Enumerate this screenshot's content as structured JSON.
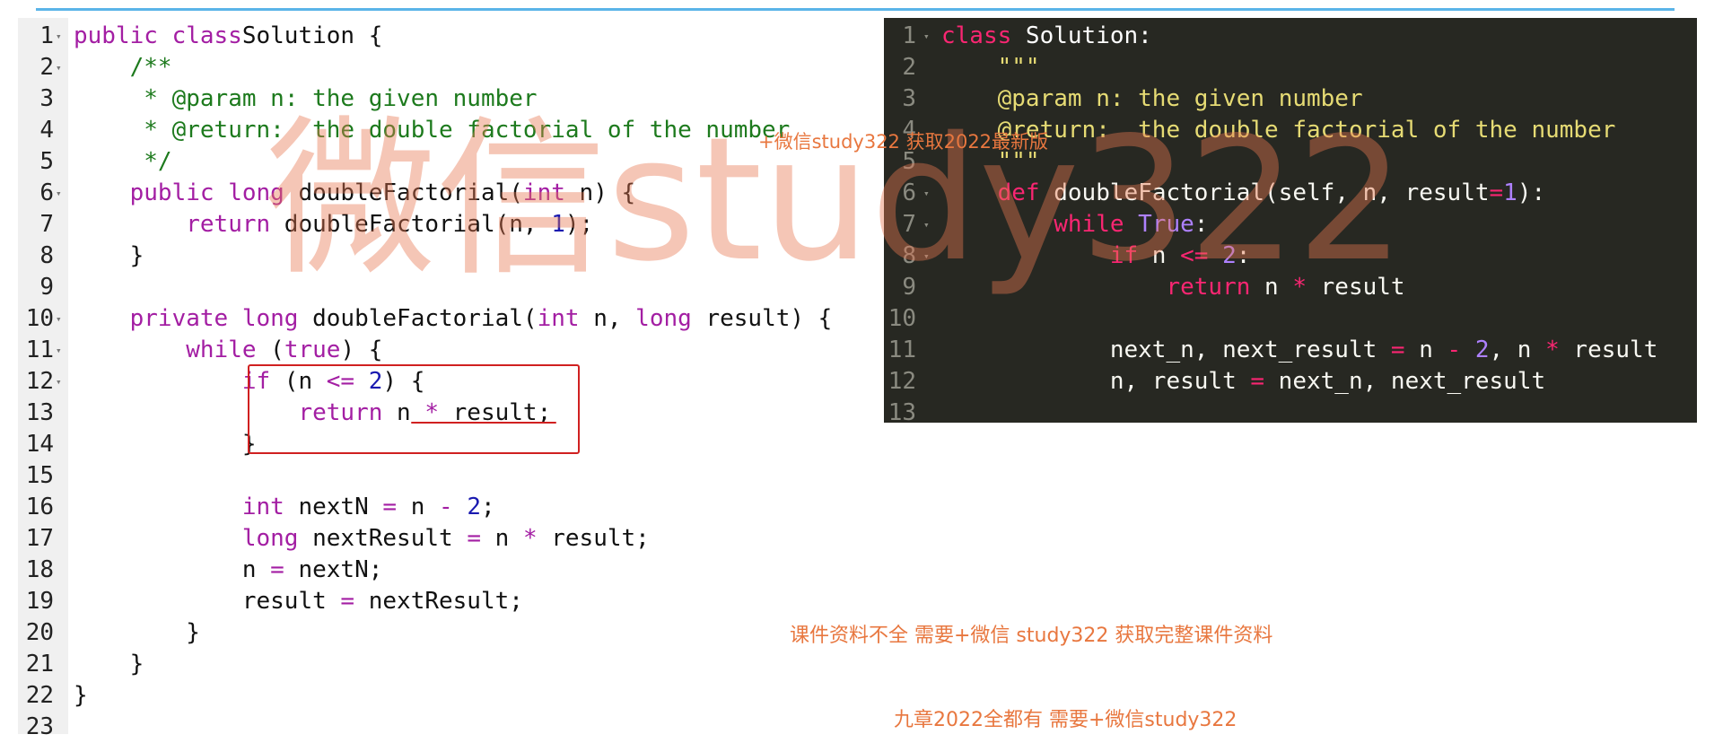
{
  "java_editor": {
    "lines": [
      {
        "n": "1",
        "fold": true,
        "t": [
          [
            "kw",
            "public class"
          ],
          [
            "",
            "Solution {"
          ]
        ]
      },
      {
        "n": "2",
        "fold": true,
        "t": [
          [
            "",
            "    "
          ],
          [
            "cm",
            "/**"
          ]
        ]
      },
      {
        "n": "3",
        "fold": false,
        "t": [
          [
            "",
            "     "
          ],
          [
            "cm",
            "* @param n: the given number"
          ]
        ]
      },
      {
        "n": "4",
        "fold": false,
        "t": [
          [
            "",
            "     "
          ],
          [
            "cm",
            "* @return:  the double factorial of the number"
          ]
        ]
      },
      {
        "n": "5",
        "fold": false,
        "t": [
          [
            "",
            "     "
          ],
          [
            "cm",
            "*/"
          ]
        ]
      },
      {
        "n": "6",
        "fold": true,
        "t": [
          [
            "",
            "    "
          ],
          [
            "kw",
            "public long"
          ],
          [
            "",
            " doubleFactorial("
          ],
          [
            "kw",
            "int"
          ],
          [
            "",
            " n) {"
          ]
        ]
      },
      {
        "n": "7",
        "fold": false,
        "t": [
          [
            "",
            "        "
          ],
          [
            "kw",
            "return"
          ],
          [
            "",
            " doubleFactorial(n, "
          ],
          [
            "nm",
            "1"
          ],
          [
            "",
            ");"
          ]
        ]
      },
      {
        "n": "8",
        "fold": false,
        "t": [
          [
            "",
            "    }"
          ]
        ]
      },
      {
        "n": "9",
        "fold": false,
        "t": []
      },
      {
        "n": "10",
        "fold": true,
        "t": [
          [
            "",
            "    "
          ],
          [
            "kw",
            "private long"
          ],
          [
            "",
            " doubleFactorial("
          ],
          [
            "kw",
            "int"
          ],
          [
            "",
            " n, "
          ],
          [
            "kw",
            "long"
          ],
          [
            "",
            " result) {"
          ]
        ]
      },
      {
        "n": "11",
        "fold": true,
        "t": [
          [
            "",
            "        "
          ],
          [
            "kw",
            "while"
          ],
          [
            "",
            " ("
          ],
          [
            "kw",
            "true"
          ],
          [
            "",
            ") {"
          ]
        ]
      },
      {
        "n": "12",
        "fold": true,
        "t": [
          [
            "",
            "            "
          ],
          [
            "kw",
            "if"
          ],
          [
            "",
            " (n "
          ],
          [
            "op",
            "<="
          ],
          [
            "",
            " "
          ],
          [
            "nm",
            "2"
          ],
          [
            "",
            ") {"
          ]
        ]
      },
      {
        "n": "13",
        "fold": false,
        "t": [
          [
            "",
            "                "
          ],
          [
            "kw",
            "return"
          ],
          [
            "",
            " n "
          ],
          [
            "op",
            "*"
          ],
          [
            "",
            " result;"
          ]
        ]
      },
      {
        "n": "14",
        "fold": false,
        "t": [
          [
            "",
            "            }"
          ]
        ]
      },
      {
        "n": "15",
        "fold": false,
        "t": []
      },
      {
        "n": "16",
        "fold": false,
        "t": [
          [
            "",
            "            "
          ],
          [
            "kw",
            "int"
          ],
          [
            "",
            " nextN "
          ],
          [
            "op",
            "="
          ],
          [
            "",
            " n "
          ],
          [
            "op",
            "-"
          ],
          [
            "",
            " "
          ],
          [
            "nm",
            "2"
          ],
          [
            "",
            ";"
          ]
        ]
      },
      {
        "n": "17",
        "fold": false,
        "t": [
          [
            "",
            "            "
          ],
          [
            "kw",
            "long"
          ],
          [
            "",
            " nextResult "
          ],
          [
            "op",
            "="
          ],
          [
            "",
            " n "
          ],
          [
            "op",
            "*"
          ],
          [
            "",
            " result;"
          ]
        ]
      },
      {
        "n": "18",
        "fold": false,
        "t": [
          [
            "",
            "            n "
          ],
          [
            "op",
            "="
          ],
          [
            "",
            " nextN;"
          ]
        ]
      },
      {
        "n": "19",
        "fold": false,
        "t": [
          [
            "",
            "            result "
          ],
          [
            "op",
            "="
          ],
          [
            "",
            " nextResult;"
          ]
        ]
      },
      {
        "n": "20",
        "fold": false,
        "t": [
          [
            "",
            "        }"
          ]
        ]
      },
      {
        "n": "21",
        "fold": false,
        "t": [
          [
            "",
            "    }"
          ]
        ]
      },
      {
        "n": "22",
        "fold": false,
        "t": [
          [
            "",
            "}"
          ]
        ]
      },
      {
        "n": "23",
        "fold": false,
        "t": []
      }
    ]
  },
  "python_editor": {
    "lines": [
      {
        "n": "1",
        "fold": true,
        "t": [
          [
            "pkw",
            "class"
          ],
          [
            "pcls",
            " Solution:"
          ]
        ]
      },
      {
        "n": "2",
        "fold": false,
        "t": [
          [
            "",
            "    "
          ],
          [
            "pstr",
            "\"\"\""
          ]
        ]
      },
      {
        "n": "3",
        "fold": false,
        "t": [
          [
            "",
            "    "
          ],
          [
            "pstr",
            "@param n: the given number"
          ]
        ]
      },
      {
        "n": "4",
        "fold": false,
        "t": [
          [
            "",
            "    "
          ],
          [
            "pstr",
            "@return:  the double factorial of the number"
          ]
        ]
      },
      {
        "n": "5",
        "fold": false,
        "t": [
          [
            "",
            "    "
          ],
          [
            "pstr",
            "\"\"\""
          ]
        ]
      },
      {
        "n": "6",
        "fold": true,
        "t": [
          [
            "",
            "    "
          ],
          [
            "pkw",
            "def"
          ],
          [
            "",
            " doubleFactorial(self, n, result"
          ],
          [
            "pkw",
            "="
          ],
          [
            "pnum",
            "1"
          ],
          [
            "",
            "):"
          ]
        ]
      },
      {
        "n": "7",
        "fold": true,
        "t": [
          [
            "",
            "        "
          ],
          [
            "pkw",
            "while"
          ],
          [
            "",
            " "
          ],
          [
            "pbi",
            "True"
          ],
          [
            "",
            ":"
          ]
        ]
      },
      {
        "n": "8",
        "fold": true,
        "t": [
          [
            "",
            "            "
          ],
          [
            "pkw",
            "if"
          ],
          [
            "",
            " n "
          ],
          [
            "pkw",
            "<="
          ],
          [
            "",
            " "
          ],
          [
            "pnum",
            "2"
          ],
          [
            "",
            ":"
          ]
        ]
      },
      {
        "n": "9",
        "fold": false,
        "t": [
          [
            "",
            "                "
          ],
          [
            "pkw",
            "return"
          ],
          [
            "",
            " n "
          ],
          [
            "pkw",
            "*"
          ],
          [
            "",
            " result"
          ]
        ]
      },
      {
        "n": "10",
        "fold": false,
        "t": []
      },
      {
        "n": "11",
        "fold": false,
        "t": [
          [
            "",
            "            next_n, next_result "
          ],
          [
            "pkw",
            "="
          ],
          [
            "",
            " n "
          ],
          [
            "pkw",
            "-"
          ],
          [
            "",
            " "
          ],
          [
            "pnum",
            "2"
          ],
          [
            "",
            ", n "
          ],
          [
            "pkw",
            "*"
          ],
          [
            "",
            " result"
          ]
        ]
      },
      {
        "n": "12",
        "fold": false,
        "t": [
          [
            "",
            "            n, result "
          ],
          [
            "pkw",
            "="
          ],
          [
            "",
            " next_n, next_result"
          ]
        ]
      },
      {
        "n": "13",
        "fold": false,
        "t": []
      }
    ]
  },
  "watermarks": {
    "big": "微信study322",
    "top": "+微信study322 获取2022最新版",
    "middle": "课件资料不全 需要+微信 study322 获取完整课件资料",
    "bottom": "九章2022全都有 需要+微信study322"
  }
}
